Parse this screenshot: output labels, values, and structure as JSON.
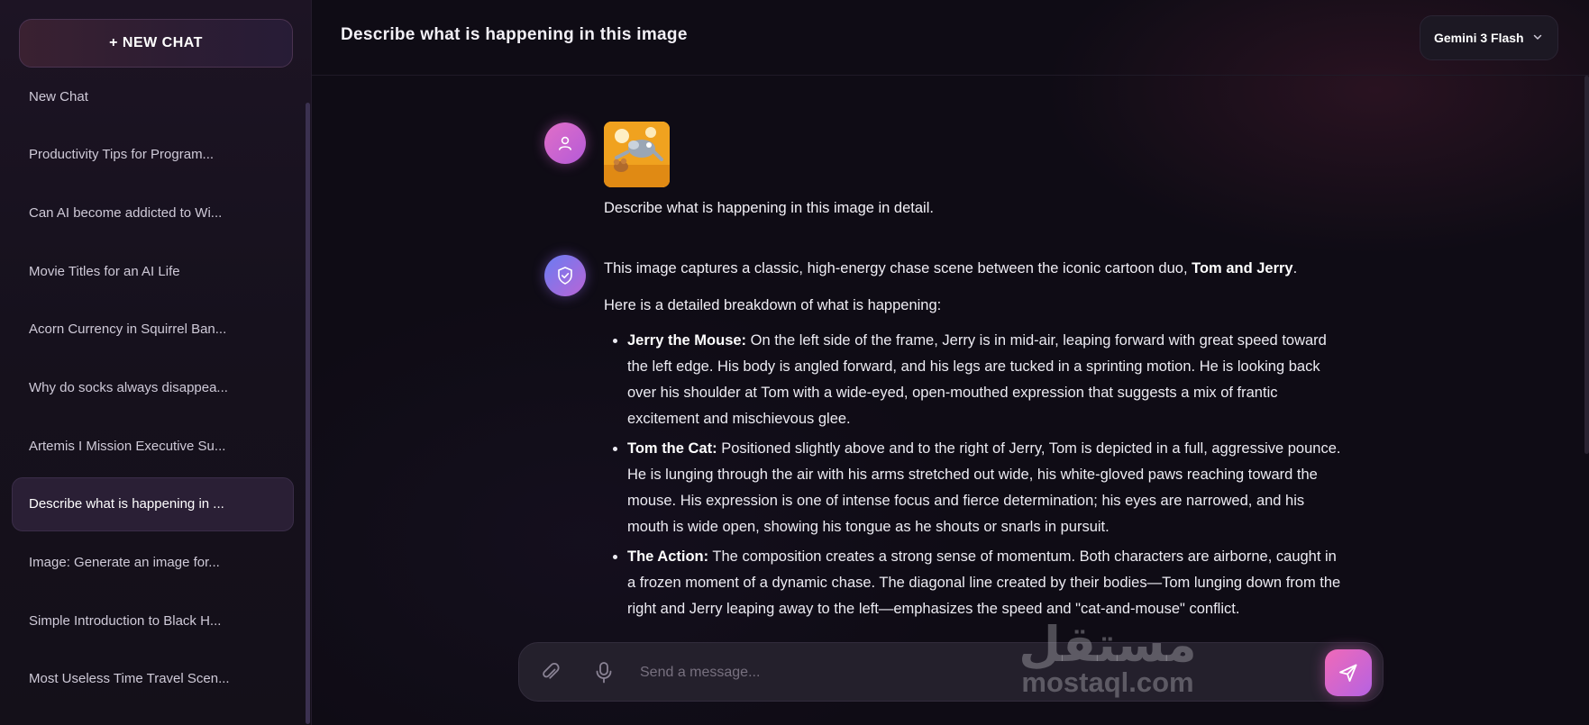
{
  "sidebar": {
    "new_chat_label": "+ NEW CHAT",
    "items": [
      {
        "label": "New Chat"
      },
      {
        "label": "Productivity Tips for Program..."
      },
      {
        "label": "Can AI become addicted to Wi..."
      },
      {
        "label": "Movie Titles for an AI Life"
      },
      {
        "label": "Acorn Currency in Squirrel Ban..."
      },
      {
        "label": "Why do socks always disappea..."
      },
      {
        "label": "Artemis I Mission Executive Su..."
      },
      {
        "label": "Describe what is happening in ..."
      },
      {
        "label": "Image: Generate an image for..."
      },
      {
        "label": "Simple Introduction to Black H..."
      },
      {
        "label": "Most Useless Time Travel Scen..."
      }
    ],
    "active_index": 7
  },
  "header": {
    "title": "Describe what is happening in this image",
    "model": "Gemini 3 Flash"
  },
  "messages": {
    "user": {
      "text": "Describe what is happening in this image in detail."
    },
    "assistant": {
      "intro": "This image captures a classic, high-energy chase scene between the iconic cartoon duo, ",
      "intro_bold": "Tom and Jerry",
      "intro_end": ".",
      "lead": "Here is a detailed breakdown of what is happening:",
      "bullets": [
        {
          "title": "Jerry the Mouse:",
          "text": " On the left side of the frame, Jerry is in mid-air, leaping forward with great speed toward the left edge. His body is angled forward, and his legs are tucked in a sprinting motion. He is looking back over his shoulder at Tom with a wide-eyed, open-mouthed expression that suggests a mix of frantic excitement and mischievous glee."
        },
        {
          "title": "Tom the Cat:",
          "text": " Positioned slightly above and to the right of Jerry, Tom is depicted in a full, aggressive pounce. He is lunging through the air with his arms stretched out wide, his white-gloved paws reaching toward the mouse. His expression is one of intense focus and fierce determination; his eyes are narrowed, and his mouth is wide open, showing his tongue as he shouts or snarls in pursuit."
        },
        {
          "title": "The Action:",
          "text": " The composition creates a strong sense of momentum. Both characters are airborne, caught in a frozen moment of a dynamic chase. The diagonal line created by their bodies—Tom lunging down from the right and Jerry leaping away to the left—emphasizes the speed and \"cat-and-mouse\" conflict."
        }
      ]
    }
  },
  "composer": {
    "placeholder": "Send a message..."
  },
  "watermark": {
    "arabic": "مستقل",
    "latin": "mostaql.com"
  },
  "colors": {
    "accent_pink": "#f06ab8",
    "accent_purple": "#b562e2",
    "background": "#0f0c15"
  }
}
